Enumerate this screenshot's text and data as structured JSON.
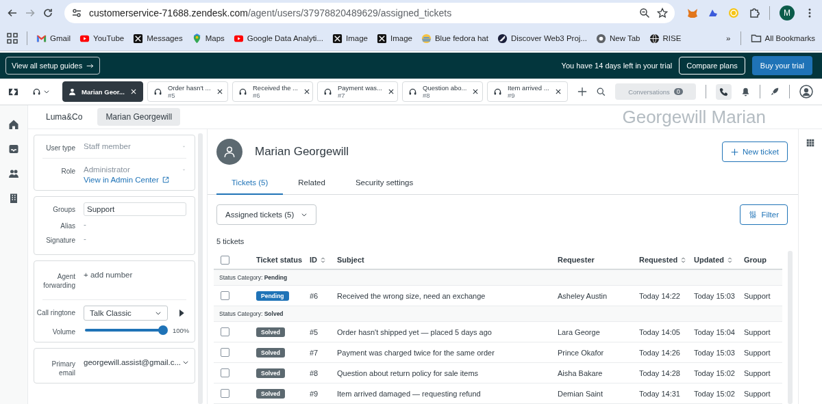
{
  "browser": {
    "url_host": "customerservice-71688.zendesk.com",
    "url_path": "/agent/users/37978820489629/assigned_tickets",
    "profile_initial": "M"
  },
  "bookmarks": [
    {
      "label": "Gmail"
    },
    {
      "label": "YouTube"
    },
    {
      "label": "Messages"
    },
    {
      "label": "Maps"
    },
    {
      "label": "Google Data Analyti..."
    },
    {
      "label": "Image"
    },
    {
      "label": "Image"
    },
    {
      "label": "Blue fedora hat"
    },
    {
      "label": "Discover Web3 Proj..."
    },
    {
      "label": "New Tab"
    },
    {
      "label": "RISE"
    }
  ],
  "bookmarks_more": "»",
  "all_bookmarks": "All Bookmarks",
  "trial_banner": {
    "guides_button": "View all setup guides",
    "message": "You have 14 days left in your trial",
    "compare_button": "Compare plans",
    "buy_button": "Buy your trial"
  },
  "workspace_tabs": [
    {
      "kind": "user",
      "title": "Marian Geor...",
      "selected": true
    },
    {
      "kind": "ticket",
      "title": "Order hasn't ...",
      "number": "#5",
      "selected": false
    },
    {
      "kind": "ticket",
      "title": "Received the ...",
      "number": "#6",
      "selected": false
    },
    {
      "kind": "ticket",
      "title": "Payment was...",
      "number": "#7",
      "selected": false
    },
    {
      "kind": "ticket",
      "title": "Question abo...",
      "number": "#8",
      "selected": false
    },
    {
      "kind": "ticket",
      "title": "Item arrived ...",
      "number": "#9",
      "selected": false
    }
  ],
  "conversations": {
    "label": "Conversations",
    "count": "0"
  },
  "breadcrumbs": [
    {
      "label": "Luma&Co",
      "selected": false
    },
    {
      "label": "Marian Georgewill",
      "selected": true
    }
  ],
  "header_title": "Georgewill Marian",
  "user_fields": {
    "user_type": {
      "label": "User type",
      "value": "Staff member"
    },
    "role": {
      "label": "Role",
      "value": "Administrator",
      "link": "View in Admin Center"
    },
    "groups": {
      "label": "Groups",
      "value": "Support"
    },
    "alias": {
      "label": "Alias",
      "value": "-"
    },
    "signature": {
      "label": "Signature",
      "value": "-"
    },
    "agent_forwarding": {
      "label": "Agent forwarding",
      "action": "+ add number"
    },
    "call_ringtone": {
      "label": "Call ringtone",
      "value": "Talk Classic"
    },
    "volume": {
      "label": "Volume",
      "level": 1.0,
      "reading": "100%"
    },
    "primary_email": {
      "label": "Primary email",
      "value": "georgewill.assist@gmail.c..."
    }
  },
  "profile": {
    "name": "Marian Georgewill",
    "new_ticket_button": "New ticket"
  },
  "profile_tabs": [
    {
      "label": "Tickets (5)",
      "selected": true
    },
    {
      "label": "Related",
      "selected": false
    },
    {
      "label": "Security settings",
      "selected": false
    }
  ],
  "view_dropdown": "Assigned tickets (5)",
  "filter_button": "Filter",
  "ticket_count": "5 tickets",
  "table": {
    "select_all_checked": false,
    "columns": [
      {
        "label": "Ticket status",
        "sortable": false
      },
      {
        "label": "ID",
        "sortable": true
      },
      {
        "label": "Subject",
        "sortable": false
      },
      {
        "label": "Requester",
        "sortable": false
      },
      {
        "label": "Requested",
        "sortable": true
      },
      {
        "label": "Updated",
        "sortable": true
      },
      {
        "label": "Group",
        "sortable": false
      }
    ],
    "groups": [
      {
        "prefix": "Status Category:",
        "category": "Pending",
        "rows": [
          {
            "checked": false,
            "status": {
              "kind": "pending",
              "label": "Pending"
            },
            "id": "#6",
            "subject": "Received the wrong size, need an exchange",
            "requester": "Asheley Austin",
            "requested": "Today 14:22",
            "updated": "Today 15:03",
            "group": "Support"
          }
        ]
      },
      {
        "prefix": "Status Category:",
        "category": "Solved",
        "rows": [
          {
            "checked": false,
            "status": {
              "kind": "solved",
              "label": "Solved"
            },
            "id": "#5",
            "subject": "Order hasn't shipped yet — placed 5 days ago",
            "requester": "Lara George",
            "requested": "Today 14:05",
            "updated": "Today 15:04",
            "group": "Support"
          },
          {
            "checked": false,
            "status": {
              "kind": "solved",
              "label": "Solved"
            },
            "id": "#7",
            "subject": "Payment was charged twice for the same order",
            "requester": "Prince Okafor",
            "requested": "Today 14:26",
            "updated": "Today 15:03",
            "group": "Support"
          },
          {
            "checked": false,
            "status": {
              "kind": "solved",
              "label": "Solved"
            },
            "id": "#8",
            "subject": "Question about return policy for sale items",
            "requester": "Aisha Bakare",
            "requested": "Today 14:28",
            "updated": "Today 15:02",
            "group": "Support"
          },
          {
            "checked": false,
            "status": {
              "kind": "solved",
              "label": "Solved"
            },
            "id": "#9",
            "subject": "Item arrived damaged — requesting refund",
            "requester": "Demian Saint",
            "requested": "Today 14:31",
            "updated": "Today 15:02",
            "group": "Support"
          }
        ]
      }
    ]
  }
}
